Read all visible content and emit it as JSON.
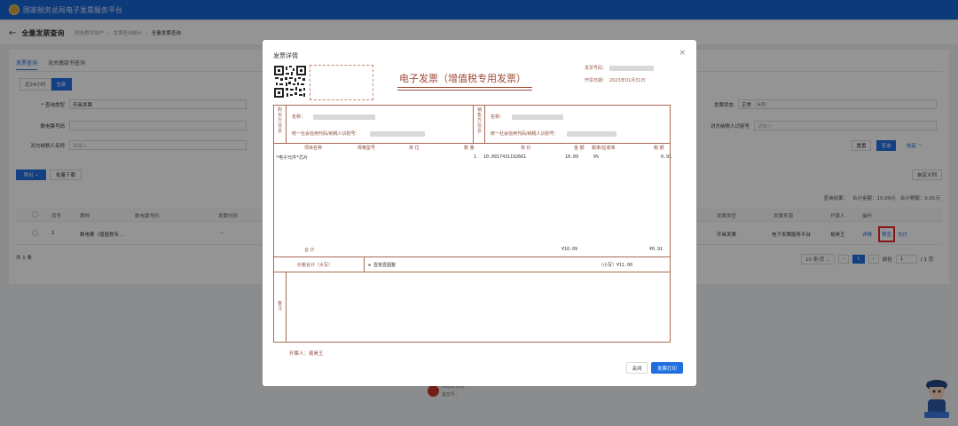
{
  "header": {
    "title": "国家税务总局电子发票服务平台"
  },
  "breadcrumb": {
    "page_title": "全量发票查询",
    "items": [
      "税务数字账户",
      "发票查询统计",
      "全量发票查询"
    ]
  },
  "tabs": [
    "发票查询",
    "海关缴款书查询"
  ],
  "range": [
    "近24小时",
    "全部"
  ],
  "filters": {
    "query_type_label": "* 查询类型",
    "query_type_value": "开具发票",
    "invoice_no_label": "数电票号码",
    "counterparty_label": "对方纳税人名称",
    "counterparty_placeholder": "请输入",
    "status_label": "发票状态",
    "status_value": "正常",
    "status_more": "+3",
    "taxid_label": "对方纳税人识别号",
    "taxid_placeholder": "请输入"
  },
  "actions": {
    "reset": "重置",
    "query": "查询",
    "collapse": "收起",
    "export": "导出",
    "batch": "批量下载",
    "custom_cols": "自定义列"
  },
  "stats": {
    "count": "查询结果：",
    "amount": "合计金额：10.09元",
    "tax": "合计税额：0.91元"
  },
  "table": {
    "headers": [
      "序号",
      "票种",
      "数电票号码",
      "发票代码",
      "发票类型",
      "发票来源",
      "开票人",
      "操作"
    ],
    "row": {
      "index": "1",
      "type": "数电票（增值税专…",
      "code": "--",
      "invtype": "开具发票",
      "source": "电子发票服务平台",
      "issuer": "易昊王",
      "op_detail": "详情",
      "op_preview": "预览",
      "op_delivery": "交付"
    }
  },
  "pager": {
    "total": "共 1 条",
    "size": "10 条/页",
    "page": "1",
    "goto": "前往",
    "goto_val": "1",
    "pages": "/ 1 页"
  },
  "footer": {
    "line1": "网站标识码：",
    "line2": "备案号："
  },
  "modal": {
    "title": "发票详情",
    "close_icon": "close-icon",
    "invoice_title": "电子发票（增值税专用发票）",
    "invoice_no_label": "发票号码：",
    "issue_date_label": "开票日期：",
    "issue_date": "2023年01月31日",
    "buyer_vertical": "购买方信息",
    "seller_vertical": "销售方信息",
    "name_label": "名称：",
    "taxid_label": "统一社会信用代码/纳税人识别号：",
    "cols": [
      "项目名称",
      "规格型号",
      "单 位",
      "数 量",
      "单 价",
      "金 额",
      "税率/征收率",
      "税 额"
    ],
    "item": {
      "name": "*电子元件*芯片",
      "qty": "1",
      "price": "10.0917431192661",
      "amount": "10.09",
      "rate": "9%",
      "tax": "0.91"
    },
    "total_label": "合 计",
    "total_amount": "¥10.09",
    "total_tax": "¥0.91",
    "grand_label": "价税合计（大写）",
    "grand_words": "⊗ 壹拾壹圆整",
    "grand_small": "（小写）¥11.00",
    "remark_vertical": "备注",
    "issuer_label": "开票人：",
    "issuer_name": "易昊王",
    "btn_close": "关闭",
    "btn_print": "发票打印"
  }
}
